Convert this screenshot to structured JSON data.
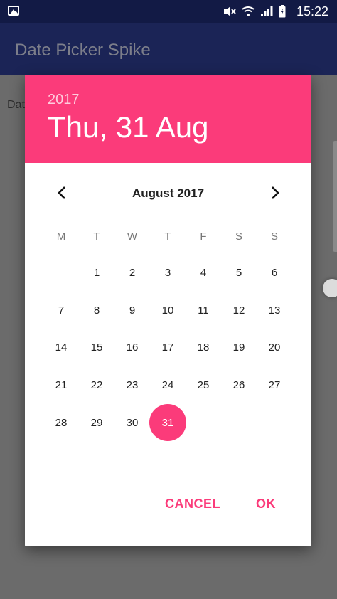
{
  "status_bar": {
    "time": "15:22",
    "icons": [
      "image-icon",
      "mute-icon",
      "wifi-icon",
      "signal-icon",
      "battery-icon"
    ]
  },
  "app_bar": {
    "title": "Date Picker Spike"
  },
  "background": {
    "label": "Dat"
  },
  "dialog": {
    "year": "2017",
    "selected_date": "Thu, 31 Aug",
    "month_title": "August 2017",
    "weekdays": [
      "M",
      "T",
      "W",
      "T",
      "F",
      "S",
      "S"
    ],
    "days": [
      "",
      "1",
      "2",
      "3",
      "4",
      "5",
      "6",
      "7",
      "8",
      "9",
      "10",
      "11",
      "12",
      "13",
      "14",
      "15",
      "16",
      "17",
      "18",
      "19",
      "20",
      "21",
      "22",
      "23",
      "24",
      "25",
      "26",
      "27",
      "28",
      "29",
      "30",
      "31",
      "",
      "",
      ""
    ],
    "selected_day": "31",
    "cancel_label": "CANCEL",
    "ok_label": "OK"
  },
  "colors": {
    "status_bar": "#121a45",
    "app_bar": "#1b2456",
    "accent": "#fb3b7a",
    "scrim": "#6b6b6b"
  }
}
